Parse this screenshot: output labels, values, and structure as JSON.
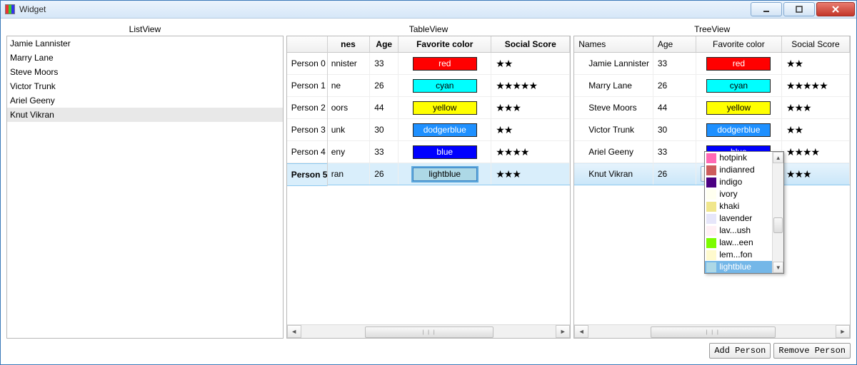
{
  "window": {
    "title": "Widget"
  },
  "sections": {
    "list": "ListView",
    "table": "TableView",
    "tree": "TreeView"
  },
  "columns": {
    "names": "Names",
    "age": "Age",
    "color": "Favorite color",
    "score": "Social Score"
  },
  "table_header_names_clipped": "nes",
  "people": [
    {
      "id": "Person 0",
      "name": "Jamie Lannister",
      "name_clipped": "nnister",
      "age": 33,
      "color": "red",
      "color_hex": "#ff0000",
      "score": 2
    },
    {
      "id": "Person 1",
      "name": "Marry Lane",
      "name_clipped": "ne",
      "age": 26,
      "color": "cyan",
      "color_hex": "#00ffff",
      "score": 5
    },
    {
      "id": "Person 2",
      "name": "Steve Moors",
      "name_clipped": "oors",
      "age": 44,
      "color": "yellow",
      "color_hex": "#ffff00",
      "score": 3
    },
    {
      "id": "Person 3",
      "name": "Victor Trunk",
      "name_clipped": "unk",
      "age": 30,
      "color": "dodgerblue",
      "color_hex": "#1e90ff",
      "score": 2
    },
    {
      "id": "Person 4",
      "name": "Ariel Geeny",
      "name_clipped": "eny",
      "age": 33,
      "color": "blue",
      "color_hex": "#0000ff",
      "score": 4
    },
    {
      "id": "Person 5",
      "name": "Knut Vikran",
      "name_clipped": "ran",
      "age": 26,
      "color": "lightblue",
      "color_hex": "#add8e6",
      "score": 3
    }
  ],
  "listview_selected_index": 5,
  "tableview_selected_index": 5,
  "treeview_selected_index": 5,
  "dropdown": {
    "open_for_tree_index": 5,
    "options": [
      {
        "label": "hotpink",
        "swatch": "#ff69b4"
      },
      {
        "label": "indianred",
        "swatch": "#cd5c5c"
      },
      {
        "label": "indigo",
        "swatch": "#4b0082"
      },
      {
        "label": "ivory",
        "swatch": "#fffff0"
      },
      {
        "label": "khaki",
        "swatch": "#f0e68c"
      },
      {
        "label": "lavender",
        "swatch": "#e6e6fa"
      },
      {
        "label": "lav...ush",
        "swatch": "#fff0f5"
      },
      {
        "label": "law...een",
        "swatch": "#7cfc00"
      },
      {
        "label": "lem...fon",
        "swatch": "#fffacd"
      },
      {
        "label": "lightblue",
        "swatch": "#add8e6"
      }
    ],
    "selected_label": "lightblue"
  },
  "buttons": {
    "add": "Add Person",
    "remove": "Remove Person"
  }
}
